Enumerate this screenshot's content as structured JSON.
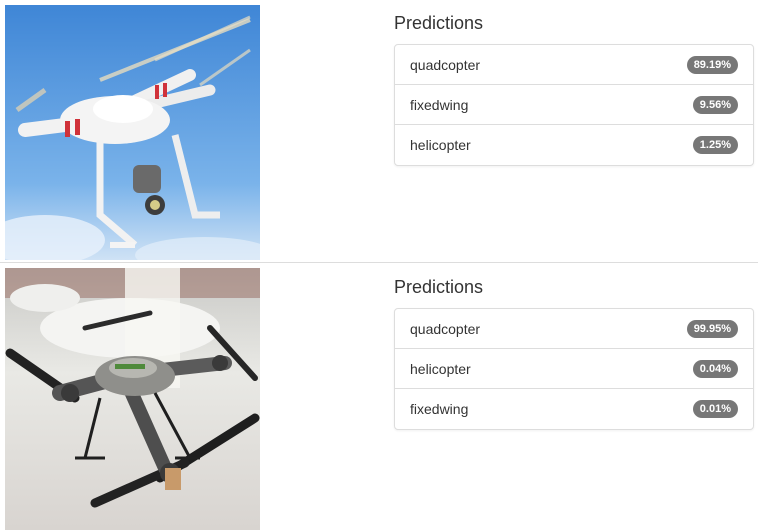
{
  "results": [
    {
      "title": "Predictions",
      "image_subject": "white quadcopter drone against blue sky",
      "predictions": [
        {
          "label": "quadcopter",
          "score": "89.19%"
        },
        {
          "label": "fixedwing",
          "score": "9.56%"
        },
        {
          "label": "helicopter",
          "score": "1.25%"
        }
      ]
    },
    {
      "title": "Predictions",
      "image_subject": "grey quadcopter drone on white display stand",
      "predictions": [
        {
          "label": "quadcopter",
          "score": "99.95%"
        },
        {
          "label": "helicopter",
          "score": "0.04%"
        },
        {
          "label": "fixedwing",
          "score": "0.01%"
        }
      ]
    }
  ],
  "colors": {
    "badge_bg": "#777777",
    "badge_text": "#ffffff",
    "border": "#dddddd",
    "text": "#333333"
  }
}
